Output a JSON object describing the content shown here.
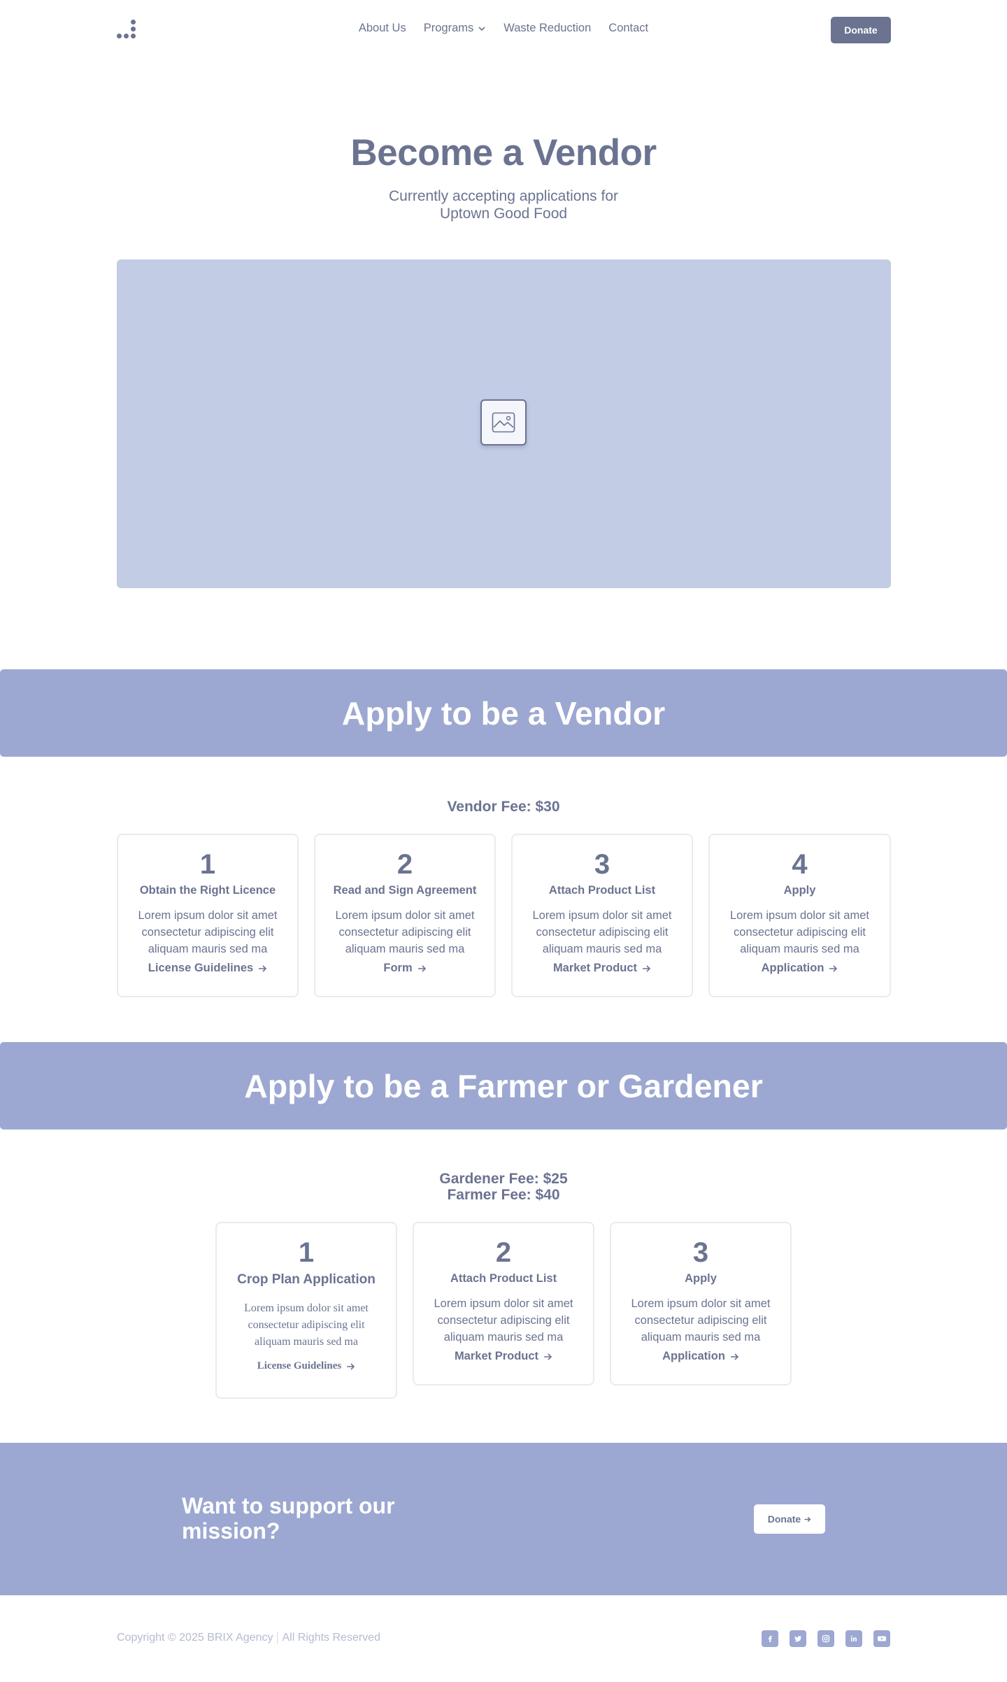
{
  "header": {
    "nav": [
      "About Us",
      "Programs",
      "Waste Reduction",
      "Contact"
    ],
    "donate_label": "Donate"
  },
  "hero": {
    "title": "Become a Vendor",
    "subtitle": "Currently accepting applications for Uptown Good Food"
  },
  "vendor": {
    "band_title": "Apply to be a Vendor",
    "fee": "Vendor Fee: $30",
    "cards": [
      {
        "num": "1",
        "title": "Obtain the Right Licence",
        "text": "Lorem ipsum dolor sit amet consectetur adipiscing elit aliquam mauris sed ma",
        "link": "License Guidelines"
      },
      {
        "num": "2",
        "title": "Read and Sign Agreement",
        "text": "Lorem ipsum dolor sit amet consectetur adipiscing elit aliquam mauris sed ma",
        "link": "Form"
      },
      {
        "num": "3",
        "title": "Attach Product List",
        "text": "Lorem ipsum dolor sit amet consectetur adipiscing elit aliquam mauris sed ma",
        "link": "Market Product"
      },
      {
        "num": "4",
        "title": "Apply",
        "text": "Lorem ipsum dolor sit amet consectetur adipiscing elit aliquam mauris sed ma",
        "link": "Application"
      }
    ]
  },
  "farmer": {
    "band_title": "Apply to be a Farmer or Gardener",
    "fee_gardener": "Gardener Fee: $25",
    "fee_farmer": "Farmer Fee: $40",
    "cards": [
      {
        "num": "1",
        "title": "Crop Plan Application",
        "text": "Lorem ipsum dolor sit amet consectetur adipiscing elit aliquam mauris sed ma",
        "link": "License Guidelines"
      },
      {
        "num": "2",
        "title": "Attach Product List",
        "text": "Lorem ipsum dolor sit amet consectetur adipiscing elit aliquam mauris sed ma",
        "link": "Market Product"
      },
      {
        "num": "3",
        "title": "Apply",
        "text": "Lorem ipsum dolor sit amet consectetur adipiscing elit aliquam mauris sed ma",
        "link": "Application"
      }
    ]
  },
  "cta": {
    "title": "Want to support our mission?",
    "button": "Donate"
  },
  "footer": {
    "copyright": "Copyright © 2025 BRIX Agency",
    "rights": "All Rights Reserved",
    "socials": [
      "facebook-icon",
      "twitter-icon",
      "instagram-icon",
      "linkedin-icon",
      "youtube-icon"
    ]
  },
  "colors": {
    "primary": "#6b7391",
    "band": "#9ca8d1",
    "image_placeholder": "#c3cce5"
  }
}
